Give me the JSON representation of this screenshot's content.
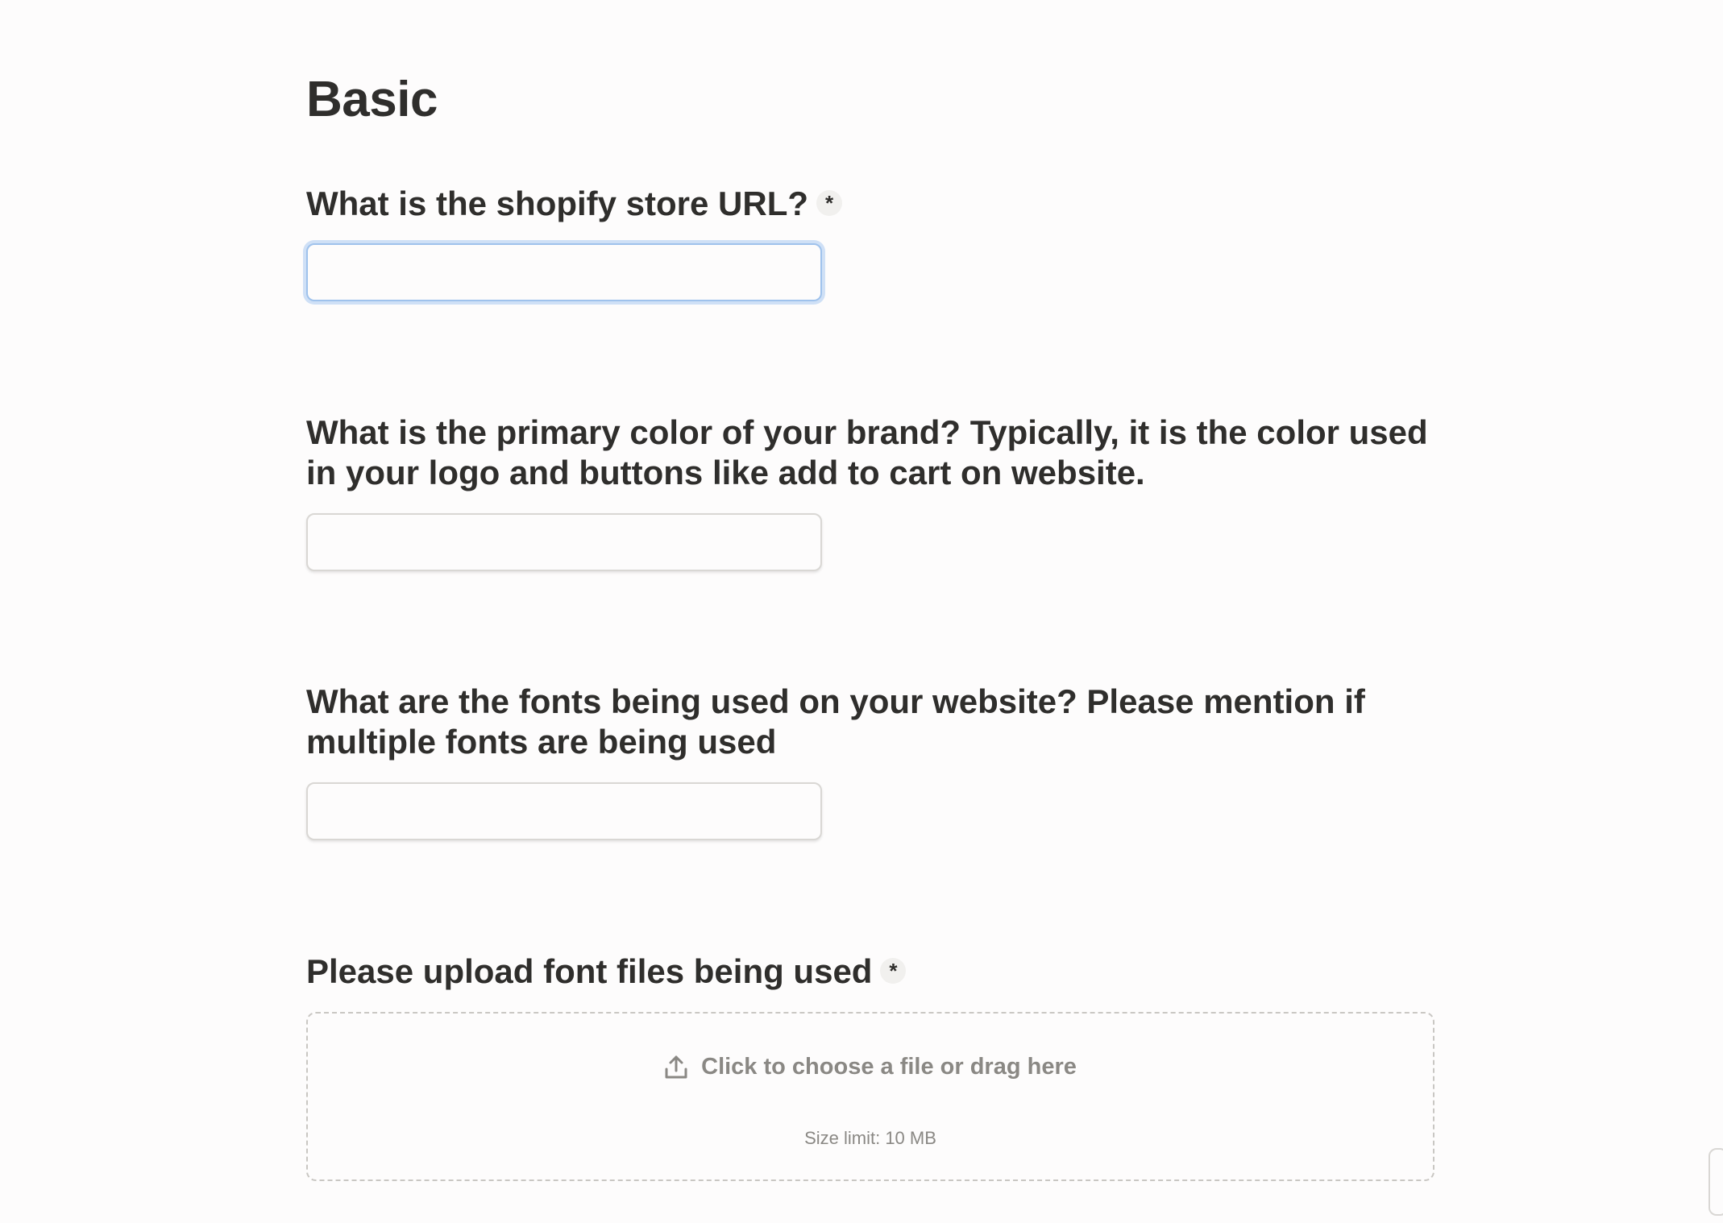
{
  "page": {
    "title": "Basic"
  },
  "questions": [
    {
      "label": "What is the shopify store URL?",
      "required": true,
      "required_mark": "*",
      "value": ""
    },
    {
      "label": "What is the primary color of your brand? Typically, it is the color used in your logo and buttons like add to cart on website.",
      "required": false,
      "value": ""
    },
    {
      "label": "What are the fonts being used on your website? Please mention if multiple fonts are being used",
      "required": false,
      "value": ""
    },
    {
      "label": "Please upload font files being used",
      "required": true,
      "required_mark": "*",
      "upload_prompt": "Click to choose a file or drag here",
      "size_limit": "Size limit: 10 MB",
      "upload_icon": "upload-icon"
    }
  ],
  "colors": {
    "focus_ring": "#9fc2ec",
    "text": "#2f2e2c",
    "muted": "#8a8884"
  }
}
